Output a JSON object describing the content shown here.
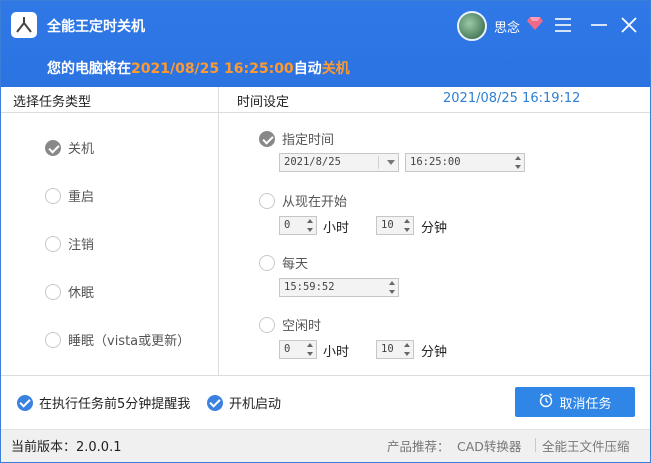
{
  "app": {
    "title": "全能王定时关机",
    "username": "思念",
    "status_prefix": "您的电脑将在",
    "status_time": "2021/08/25 16:25:00",
    "status_mid": "自动",
    "status_action": "关机"
  },
  "header": {
    "task_type_label": "选择任务类型",
    "time_setting_label": "时间设定",
    "current_time": "2021/08/25 16:19:12"
  },
  "tasks": [
    {
      "label": "关机",
      "checked": true
    },
    {
      "label": "重启",
      "checked": false
    },
    {
      "label": "注销",
      "checked": false
    },
    {
      "label": "休眠",
      "checked": false
    },
    {
      "label": "睡眠（vista或更新）",
      "checked": false
    }
  ],
  "time_options": {
    "specified": {
      "label": "指定时间",
      "checked": true,
      "date_value": "2021/8/25",
      "time_value": "16:25:00"
    },
    "from_now": {
      "label": "从现在开始",
      "checked": false,
      "hours": "0",
      "hours_unit": "小时",
      "minutes": "10",
      "minutes_unit": "分钟"
    },
    "daily": {
      "label": "每天",
      "checked": false,
      "time_value": "15:59:52"
    },
    "idle": {
      "label": "空闲时",
      "checked": false,
      "hours": "0",
      "hours_unit": "小时",
      "minutes": "10",
      "minutes_unit": "分钟"
    }
  },
  "bottom": {
    "remind_label": "在执行任务前5分钟提醒我",
    "autostart_label": "开机启动",
    "cancel_button": "取消任务"
  },
  "footer": {
    "version": "当前版本：2.0.0.1",
    "recommend_label": "产品推荐：",
    "link1": "CAD转换器",
    "link2": "全能王文件压缩"
  },
  "colors": {
    "titlebar": "#2f78e6",
    "highlight": "#ff9a2e",
    "accent_blue": "#2f86e6",
    "time_blue": "#2d7fd4"
  },
  "icons": {
    "logo": "app-logo-icon",
    "vip": "diamond-icon",
    "menu": "hamburger-menu-icon",
    "minimize": "minimize-icon",
    "close": "close-icon",
    "alarm": "alarm-clock-icon"
  }
}
